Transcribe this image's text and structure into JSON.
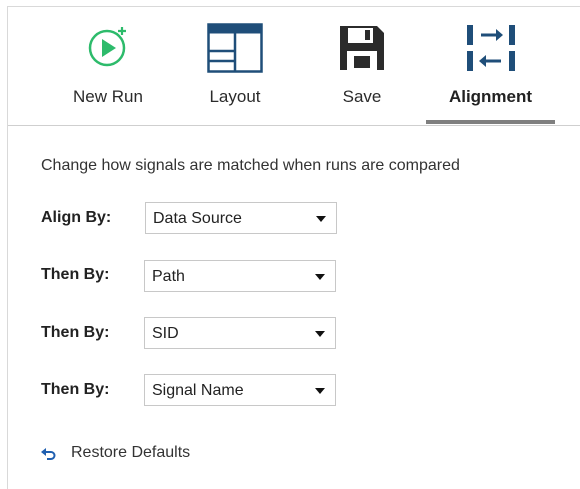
{
  "toolbar": {
    "items": [
      {
        "label": "New Run",
        "icon": "new-run-icon"
      },
      {
        "label": "Layout",
        "icon": "layout-icon"
      },
      {
        "label": "Save",
        "icon": "floppy-disk-icon"
      },
      {
        "label": "Alignment",
        "icon": "alignment-icon",
        "active": true
      }
    ]
  },
  "description": "Change how signals are matched when runs are compared",
  "rows": [
    {
      "label": "Align By:",
      "value": "Data Source"
    },
    {
      "label": "Then By:",
      "value": "Path"
    },
    {
      "label": "Then By:",
      "value": "SID"
    },
    {
      "label": "Then By:",
      "value": "Signal Name"
    }
  ],
  "restore": {
    "label": "Restore Defaults",
    "icon": "undo-icon"
  },
  "colors": {
    "new_run_green": "#2dbb6b",
    "icon_blue": "#1f4e79",
    "active_underline": "#7f7f7f"
  }
}
